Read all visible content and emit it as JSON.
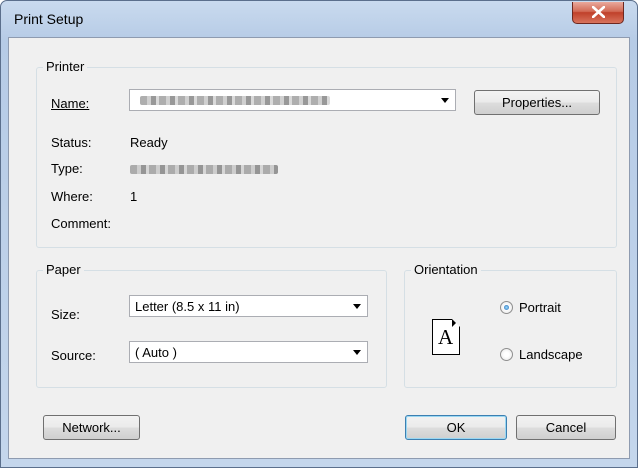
{
  "window": {
    "title": "Print Setup"
  },
  "printer": {
    "group_label": "Printer",
    "name_label": "Name:",
    "properties_label": "Properties...",
    "status_label": "Status:",
    "status_value": "Ready",
    "type_label": "Type:",
    "where_label": "Where:",
    "where_value": "1",
    "comment_label": "Comment:"
  },
  "paper": {
    "group_label": "Paper",
    "size_label": "Size:",
    "size_value": "Letter (8.5 x 11 in)",
    "source_label": "Source:",
    "source_value": "( Auto )"
  },
  "orientation": {
    "group_label": "Orientation",
    "portrait_label": "Portrait",
    "landscape_label": "Landscape",
    "selected": "Portrait",
    "preview_glyph": "A"
  },
  "buttons": {
    "network": "Network...",
    "ok": "OK",
    "cancel": "Cancel"
  },
  "colors": {
    "titlebar": "#c4d6ec",
    "close_button": "#c7432c",
    "dialog_face": "#f0f0f0"
  }
}
